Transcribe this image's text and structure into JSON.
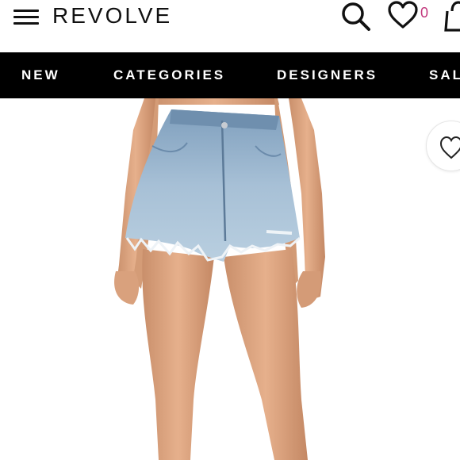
{
  "header": {
    "logo": "REVOLVE",
    "wishlist_count": "0",
    "icons": [
      "menu-icon",
      "search-icon",
      "heart-icon",
      "bag-icon"
    ]
  },
  "nav": {
    "items": [
      {
        "label": "NEW"
      },
      {
        "label": "CATEGORIES"
      },
      {
        "label": "DESIGNERS"
      },
      {
        "label": "SALE"
      }
    ]
  },
  "product": {
    "image_alt": "model wearing distressed light-wash high-rise denim shorts",
    "favorite_icon": "heart-outline-icon"
  },
  "colors": {
    "nav_background": "#000000",
    "nav_text": "#ffffff",
    "wishlist_count": "#c2387d"
  }
}
